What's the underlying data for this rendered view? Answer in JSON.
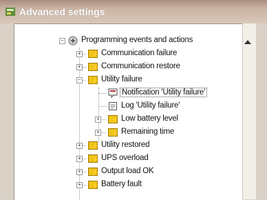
{
  "window": {
    "title": "Advanced settings"
  },
  "tree": {
    "root": "Programming events and actions",
    "items": [
      {
        "label": "Communication failure"
      },
      {
        "label": "Communication restore"
      },
      {
        "label": "Utility failure"
      },
      {
        "label": "Notification 'Utility failure'"
      },
      {
        "label": "Log 'Utility failure'"
      },
      {
        "label": "Low battery level"
      },
      {
        "label": "Remaining time"
      },
      {
        "label": "Utility restored"
      },
      {
        "label": "UPS overload"
      },
      {
        "label": "Output load OK"
      },
      {
        "label": "Battery fault"
      }
    ]
  },
  "colors": {
    "titlebar": "#a88d7e",
    "event_icon": "#f0c419"
  }
}
